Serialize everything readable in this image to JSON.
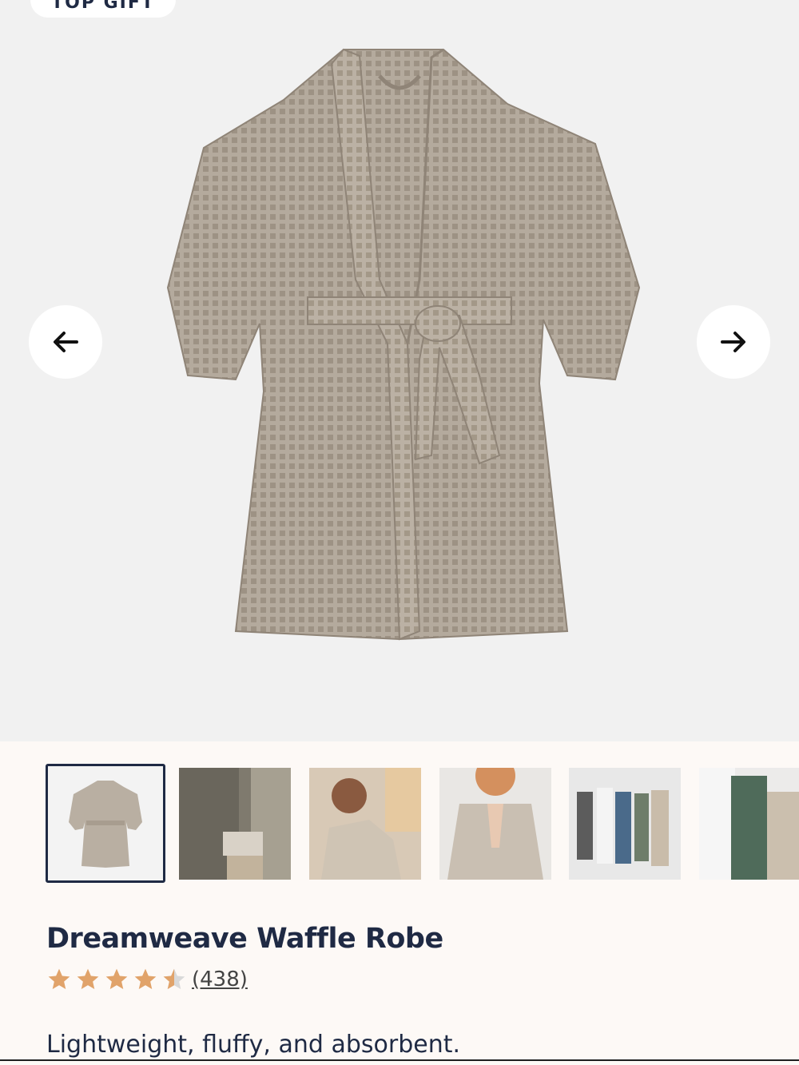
{
  "badge": {
    "label": "TOP GIFT"
  },
  "gallery": {
    "prev_icon": "arrow-left-icon",
    "next_icon": "arrow-right-icon",
    "thumbnails": [
      {
        "name": "thumb-robe-flat",
        "selected": true
      },
      {
        "name": "thumb-robe-with-towels",
        "selected": false
      },
      {
        "name": "thumb-man-in-robe",
        "selected": false
      },
      {
        "name": "thumb-woman-in-robe",
        "selected": false
      },
      {
        "name": "thumb-group-in-robes",
        "selected": false
      },
      {
        "name": "thumb-robes-closeup",
        "selected": false
      }
    ]
  },
  "product": {
    "title": "Dreamweave Waffle Robe",
    "rating": 4.5,
    "review_count": "(438)",
    "description": "Lightweight, fluffy, and absorbent."
  },
  "colors": {
    "navy": "#1f2a44",
    "star": "#e1a36a",
    "robe": "#b2a89b"
  }
}
